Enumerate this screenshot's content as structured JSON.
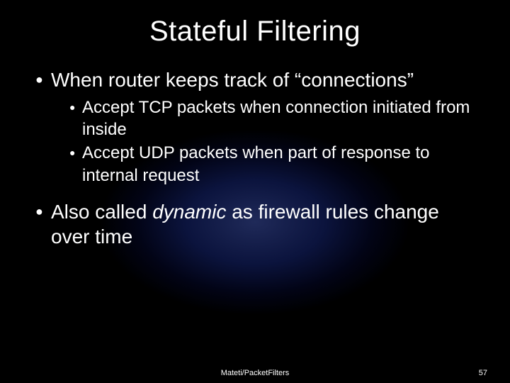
{
  "title": "Stateful Filtering",
  "bullets": {
    "b1": "When router keeps track of “connections”",
    "b1_sub": {
      "s1": "Accept TCP packets when connection initiated from inside",
      "s2": "Accept UDP packets when part of response to internal request"
    },
    "b2_pre": "Also called ",
    "b2_em": "dynamic",
    "b2_post": " as firewall rules change over time"
  },
  "footer": {
    "source": "Mateti/PacketFilters",
    "page": "57"
  }
}
